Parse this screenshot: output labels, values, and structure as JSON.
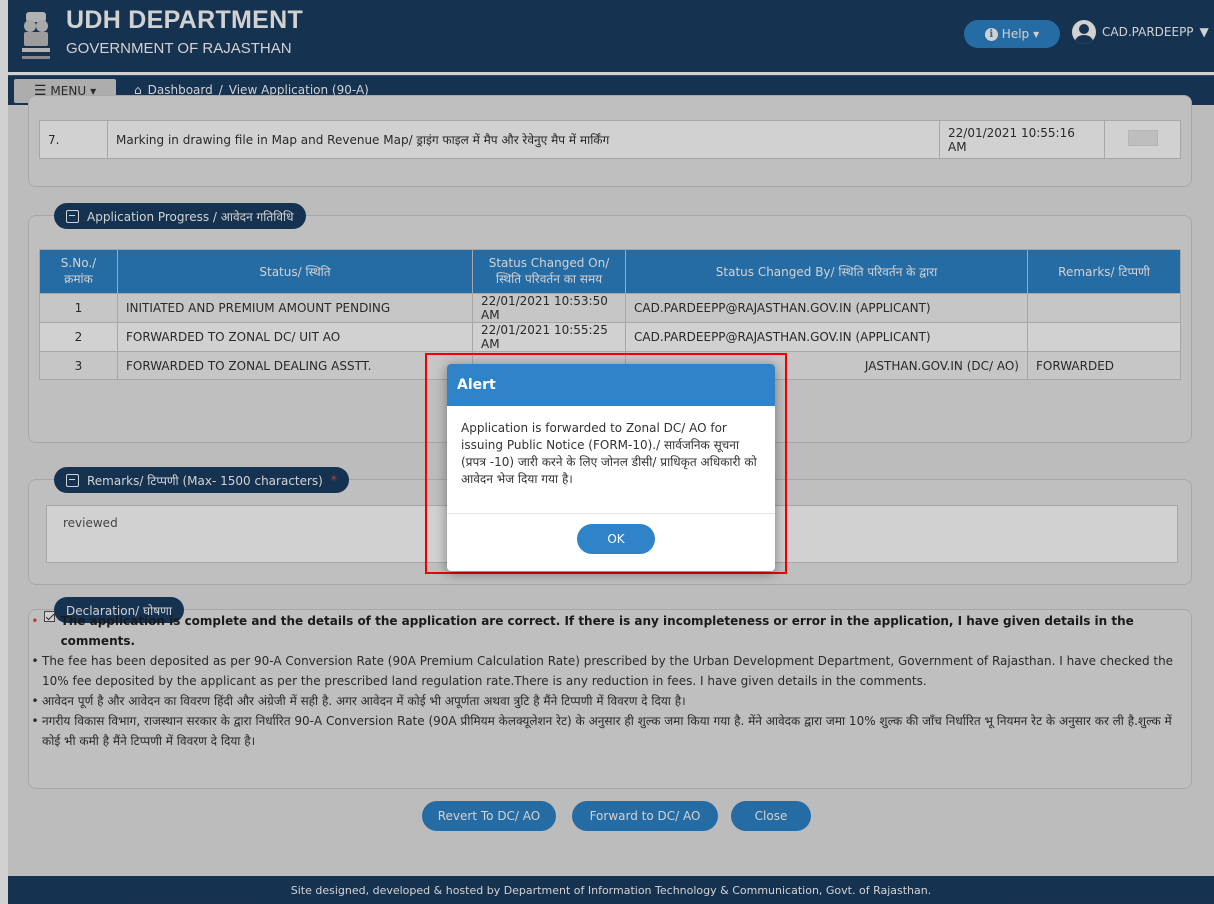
{
  "header": {
    "title": "UDH DEPARTMENT",
    "subtitle": "GOVERNMENT OF RAJASTHAN",
    "help_label": "Help",
    "user_name": "CAD.PARDEEPP"
  },
  "nav": {
    "menu_label": "MENU",
    "breadcrumb_home": "Dashboard",
    "breadcrumb_sep": "/",
    "breadcrumb_current": "View Application (90-A)"
  },
  "top_table": {
    "row": {
      "sno": "7.",
      "task": "Marking in drawing file in Map and Revenue Map/ ड्राइंग फाइल में मैप और रेवेनुए मैप में मार्किंग",
      "date": "22/01/2021 10:55:16 AM"
    }
  },
  "progress": {
    "legend": "Application Progress / आवेदन गतिविधि",
    "headers": {
      "sno": "S.No./ क्रमांक",
      "status": "Status/ स्थिति",
      "changed_on": "Status Changed On/ स्थिति परिवर्तन का समय",
      "changed_by": "Status Changed By/ स्थिति परिवर्तन के द्वारा",
      "remarks": "Remarks/ टिप्पणी"
    },
    "rows": [
      {
        "sno": "1",
        "status": "INITIATED AND PREMIUM AMOUNT PENDING",
        "changed_on": "22/01/2021 10:53:50 AM",
        "changed_by": "CAD.PARDEEPP@RAJASTHAN.GOV.IN (APPLICANT)",
        "remarks": ""
      },
      {
        "sno": "2",
        "status": "FORWARDED TO ZONAL DC/ UIT AO",
        "changed_on": "22/01/2021 10:55:25 AM",
        "changed_by": "CAD.PARDEEPP@RAJASTHAN.GOV.IN (APPLICANT)",
        "remarks": ""
      },
      {
        "sno": "3",
        "status": "FORWARDED TO ZONAL DEALING ASSTT.",
        "changed_on": "",
        "changed_by": "JASTHAN.GOV.IN (DC/ AO)",
        "remarks": "FORWARDED"
      }
    ]
  },
  "remarks": {
    "legend": "Remarks/ टिप्पणी (Max- 1500 characters)",
    "required_mark": "*",
    "value": "reviewed"
  },
  "declaration": {
    "legend": "Declaration/ घोषणा",
    "items": [
      "The application is complete and the details of the application are correct. If there is any incompleteness or error in the application, I have given details in the comments.",
      "The fee has been deposited as per 90-A Conversion Rate (90A Premium Calculation Rate) prescribed by the Urban Development Department, Government of Rajasthan. I have checked the 10% fee deposited by the applicant as per the prescribed land regulation rate.There is any reduction in fees. I have given details in the comments.",
      "आवेदन पूर्ण है और आवेदन का विवरण हिंदी और अंग्रेजी में सही है. अगर आवेदन में कोई भी अपूर्णता अथवा त्रुटि है मैंने टिप्पणी में विवरण दे दिया है।",
      "नगरीय विकास विभाग, राजस्थान सरकार के द्वारा निर्धारित 90-A Conversion Rate (90A प्रीमियम केलक्यूलेशन रेट) के अनुसार ही शुल्क जमा किया गया है. मेंने आवेदक द्वारा जमा 10% शुल्क की जाँच निर्धारित भू नियमन रेट के अनुसार कर ली है.शुल्क में कोई भी कमी है मैंने टिप्पणी में विवरण दे दिया है।"
    ]
  },
  "actions": {
    "revert": "Revert To DC/ AO",
    "forward": "Forward to DC/ AO",
    "close": "Close"
  },
  "footer": "Site designed, developed & hosted by Department of Information Technology & Communication, Govt. of Rajasthan.",
  "alert": {
    "title": "Alert",
    "message": "Application is forwarded to Zonal DC/ AO for issuing Public Notice (FORM-10)./ सार्वजनिक सूचना (प्रपत्र -10) जारी करने के लिए जोनल डीसी/ प्राधिकृत अधिकारी को आवेदन भेज दिया गया है।",
    "ok": "OK"
  },
  "colors": {
    "navy": "#1c3d63",
    "accent_blue": "#2f84c9",
    "highlight_red": "#e00000"
  }
}
